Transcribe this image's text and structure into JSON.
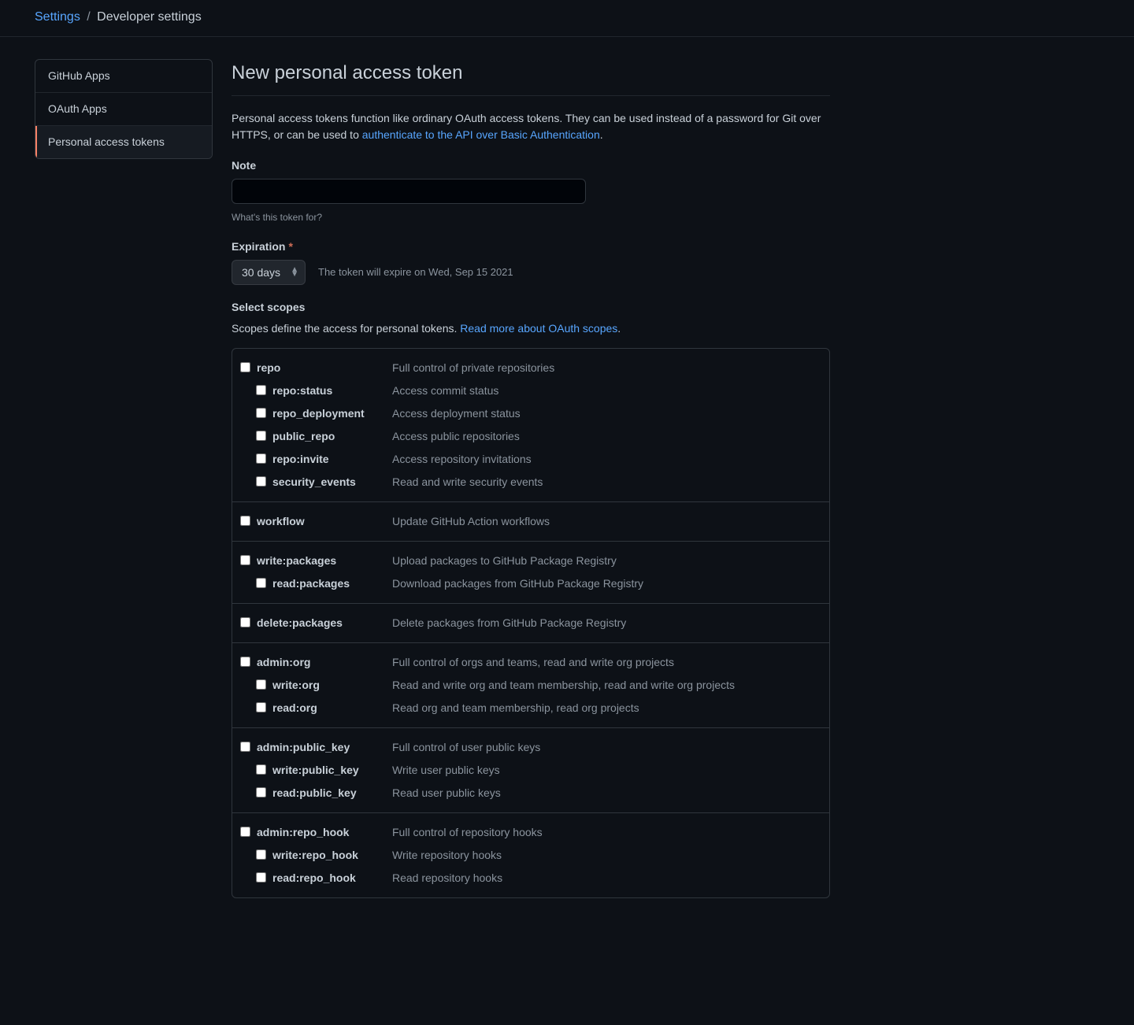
{
  "breadcrumb": {
    "root": "Settings",
    "current": "Developer settings"
  },
  "sidebar": {
    "items": [
      {
        "label": "GitHub Apps",
        "selected": false
      },
      {
        "label": "OAuth Apps",
        "selected": false
      },
      {
        "label": "Personal access tokens",
        "selected": true
      }
    ]
  },
  "page": {
    "title": "New personal access token",
    "intro_before": "Personal access tokens function like ordinary OAuth access tokens. They can be used instead of a password for Git over HTTPS, or can be used to ",
    "intro_link": "authenticate to the API over Basic Authentication",
    "intro_after": "."
  },
  "note": {
    "label": "Note",
    "value": "",
    "hint": "What's this token for?"
  },
  "expiration": {
    "label": "Expiration",
    "value": "30 days",
    "hint": "The token will expire on Wed, Sep 15 2021"
  },
  "scopes": {
    "header": "Select scopes",
    "desc_before": "Scopes define the access for personal tokens. ",
    "desc_link": "Read more about OAuth scopes",
    "desc_after": ".",
    "groups": [
      {
        "name": "repo",
        "desc": "Full control of private repositories",
        "children": [
          {
            "name": "repo:status",
            "desc": "Access commit status"
          },
          {
            "name": "repo_deployment",
            "desc": "Access deployment status"
          },
          {
            "name": "public_repo",
            "desc": "Access public repositories"
          },
          {
            "name": "repo:invite",
            "desc": "Access repository invitations"
          },
          {
            "name": "security_events",
            "desc": "Read and write security events"
          }
        ]
      },
      {
        "name": "workflow",
        "desc": "Update GitHub Action workflows",
        "children": []
      },
      {
        "name": "write:packages",
        "desc": "Upload packages to GitHub Package Registry",
        "children": [
          {
            "name": "read:packages",
            "desc": "Download packages from GitHub Package Registry"
          }
        ]
      },
      {
        "name": "delete:packages",
        "desc": "Delete packages from GitHub Package Registry",
        "children": []
      },
      {
        "name": "admin:org",
        "desc": "Full control of orgs and teams, read and write org projects",
        "children": [
          {
            "name": "write:org",
            "desc": "Read and write org and team membership, read and write org projects"
          },
          {
            "name": "read:org",
            "desc": "Read org and team membership, read org projects"
          }
        ]
      },
      {
        "name": "admin:public_key",
        "desc": "Full control of user public keys",
        "children": [
          {
            "name": "write:public_key",
            "desc": "Write user public keys"
          },
          {
            "name": "read:public_key",
            "desc": "Read user public keys"
          }
        ]
      },
      {
        "name": "admin:repo_hook",
        "desc": "Full control of repository hooks",
        "children": [
          {
            "name": "write:repo_hook",
            "desc": "Write repository hooks"
          },
          {
            "name": "read:repo_hook",
            "desc": "Read repository hooks"
          }
        ]
      }
    ]
  }
}
